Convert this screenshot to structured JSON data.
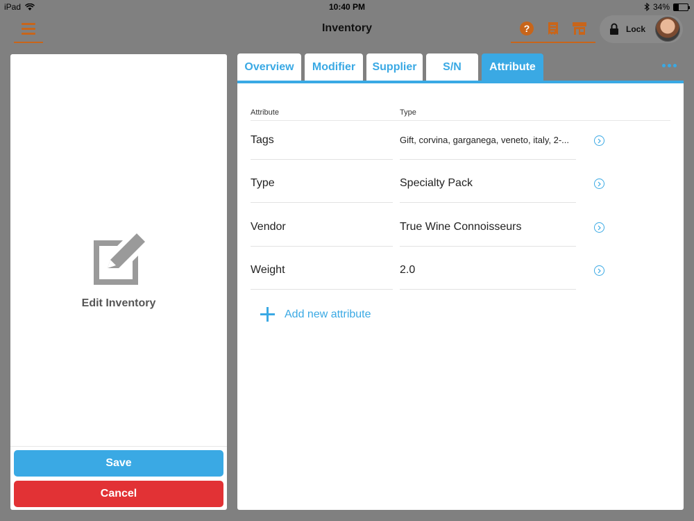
{
  "status_bar": {
    "device": "iPad",
    "time": "10:40 PM",
    "battery_text": "34%",
    "battery_level": 0.34,
    "icons": [
      "wifi-icon",
      "bluetooth-icon",
      "battery-icon"
    ]
  },
  "nav": {
    "title": "Inventory",
    "menu_icon": "hamburger-menu-icon",
    "action_icons": [
      "help-icon",
      "receipt-icon",
      "store-icon"
    ],
    "lock_label": "Lock",
    "lock_icon": "lock-icon"
  },
  "left_panel": {
    "icon": "edit-icon",
    "title": "Edit Inventory",
    "save_label": "Save",
    "cancel_label": "Cancel"
  },
  "tabs": [
    {
      "label": "Overview",
      "active": false
    },
    {
      "label": "Modifier",
      "active": false
    },
    {
      "label": "Supplier",
      "active": false
    },
    {
      "label": "S/N",
      "active": false
    },
    {
      "label": "Attribute",
      "active": true
    }
  ],
  "table": {
    "headers": {
      "attribute": "Attribute",
      "type": "Type"
    },
    "rows": [
      {
        "attribute": "Tags",
        "type": "Gift, corvina, garganega, veneto, italy, 2-..."
      },
      {
        "attribute": "Type",
        "type": "Specialty Pack"
      },
      {
        "attribute": "Vendor",
        "type": "True Wine Connoisseurs"
      },
      {
        "attribute": "Weight",
        "type": "2.0"
      }
    ],
    "add_label": "Add new attribute"
  },
  "colors": {
    "accent_blue": "#3aa9e4",
    "accent_orange": "#c8651a",
    "cancel_red": "#e23235",
    "backdrop": "#808080"
  }
}
